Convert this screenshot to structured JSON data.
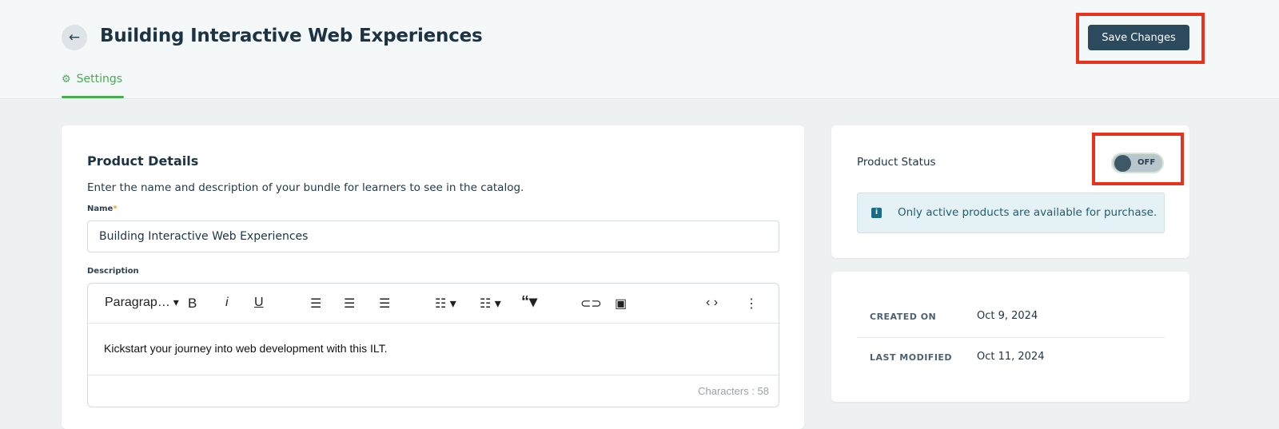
{
  "header": {
    "title": "Building Interactive Web Experiences",
    "back_icon": "arrow-left-icon",
    "tab": "Settings",
    "tab_icon": "gear-icon",
    "save_label": "Save Changes"
  },
  "colors": {
    "accent": "#4caa55",
    "primary_button": "#2b4a5e",
    "highlight": "#e8321e"
  },
  "details": {
    "heading": "Product Details",
    "subtitle": "Enter the name and description of your bundle for learners to see in the catalog.",
    "name_label": "Name",
    "required_mark": "*",
    "name_value": "Building Interactive Web Experiences",
    "description_label": "Description",
    "toolbar": {
      "paragraph": "Paragrap…",
      "bold": "B",
      "italic": "i",
      "underline": "U"
    },
    "description_value": "Kickstart your journey into web development with this ILT.",
    "characters": "Characters : 58"
  },
  "status": {
    "label": "Product Status",
    "toggle": "OFF",
    "toggle_on": false,
    "info": "Only active products are available for purchase."
  },
  "meta": {
    "created_label": "CREATED ON",
    "created_value": "Oct 9, 2024",
    "modified_label": "LAST MODIFIED",
    "modified_value": "Oct 11, 2024"
  }
}
